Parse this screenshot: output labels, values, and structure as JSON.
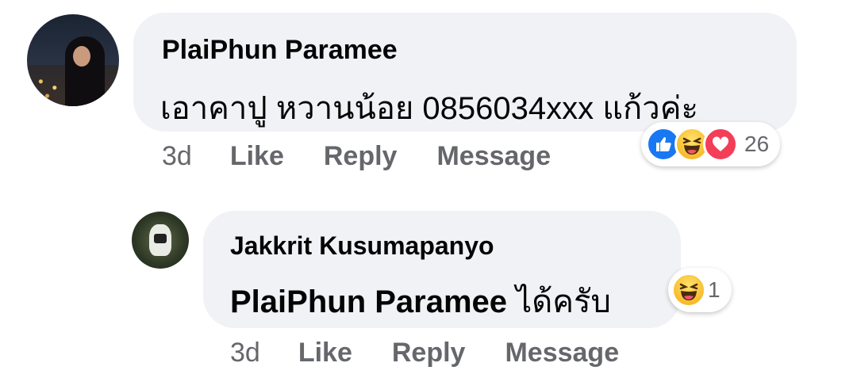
{
  "comments": [
    {
      "author": "PlaiPhun Paramee",
      "text": "เอาคาปู หวานน้อย 0856034xxx แก้วค่ะ",
      "time": "3d",
      "actions": [
        "Like",
        "Reply",
        "Message"
      ],
      "reactions": {
        "icons": [
          "like-icon",
          "haha-icon",
          "love-icon"
        ],
        "count": "26"
      }
    },
    {
      "author": "Jakkrit Kusumapanyo",
      "mention": "PlaiPhun Paramee",
      "text": " ได้ครับ",
      "time": "3d",
      "actions": [
        "Like",
        "Reply",
        "Message"
      ],
      "reactions": {
        "icons": [
          "haha-icon"
        ],
        "count": "1"
      }
    }
  ],
  "colors": {
    "bubble": "#f0f2f5",
    "meta_text": "#65676b",
    "like": "#1877f2",
    "haha": "#f7b928",
    "love": "#f33e58"
  }
}
